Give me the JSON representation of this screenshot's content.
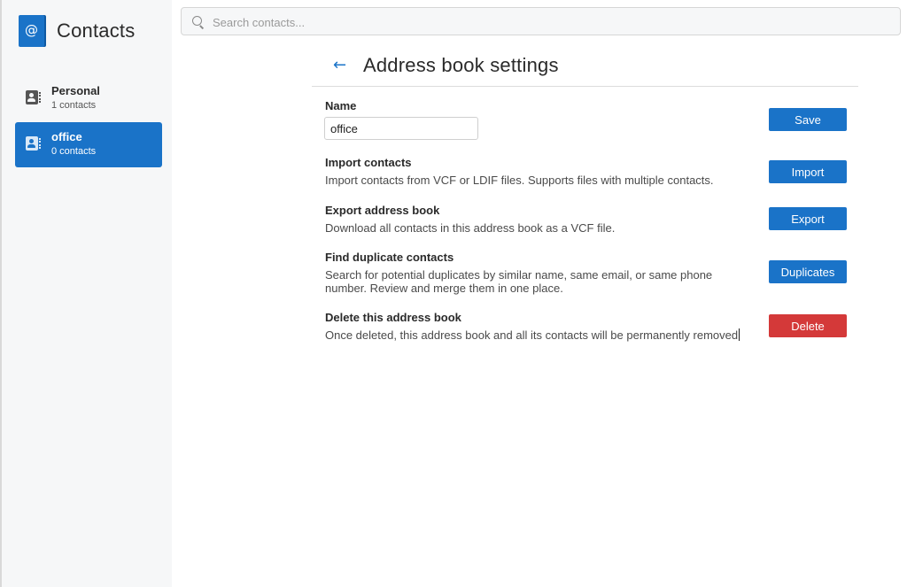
{
  "app": {
    "title": "Contacts",
    "logo_glyph": "@",
    "logo_color": "#1a73c8"
  },
  "search": {
    "placeholder": "Search contacts...",
    "value": ""
  },
  "sidebar": {
    "items": [
      {
        "name": "Personal",
        "count": "1 contacts",
        "icon": "address-book-icon",
        "selected": false
      },
      {
        "name": "office",
        "count": "0 contacts",
        "icon": "address-book-icon",
        "selected": true
      }
    ]
  },
  "settings": {
    "back_icon": "←",
    "title": "Address book settings",
    "name_label": "Name",
    "name_value": "office",
    "save_label": "Save",
    "import_title": "Import contacts",
    "import_desc": "Import contacts from VCF or LDIF files. Supports files with multiple contacts.",
    "import_label": "Import",
    "export_title": "Export address book",
    "export_desc": "Download all contacts in this address book as a VCF file.",
    "export_label": "Export",
    "duplicates_title": "Find duplicate contacts",
    "duplicates_desc_line1": "Search for potential duplicates by similar name, same email, or same phone",
    "duplicates_desc_line2": "number. Review and merge them in one place.",
    "duplicates_label": "Duplicates",
    "delete_title": "Delete this address book",
    "delete_desc": "Once deleted, this address book and all its contacts will be permanently removed",
    "delete_label": "Delete"
  },
  "colors": {
    "accent": "#1a73c8",
    "danger": "#d43939",
    "sidebar_bg": "#f6f7f8"
  }
}
